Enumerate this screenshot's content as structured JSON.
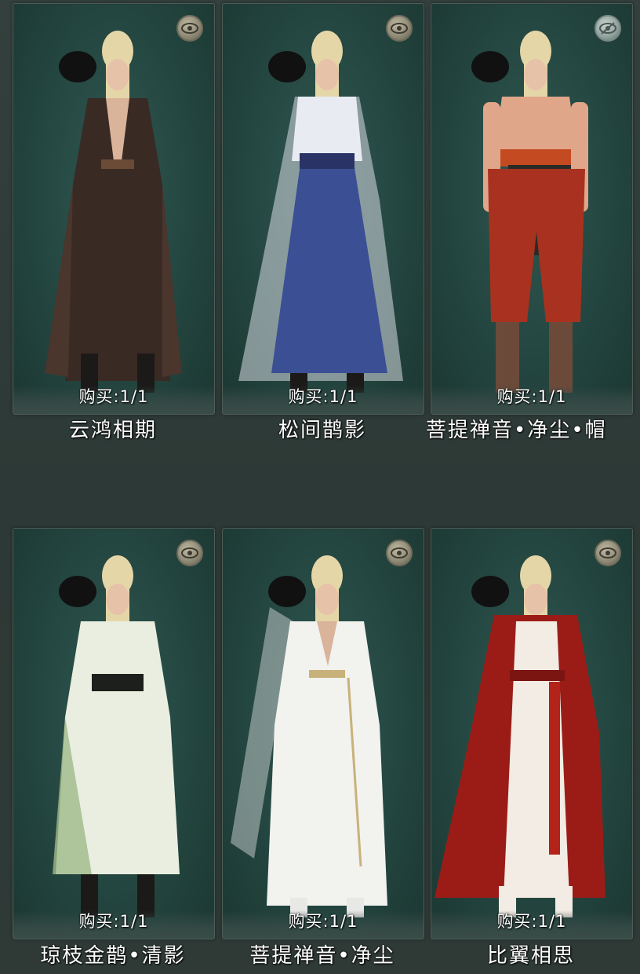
{
  "items": [
    {
      "name": "云鸿相期",
      "buy": "购买:1/1",
      "eye": "eye-icon",
      "outfit": "dark-robe",
      "colors": {
        "robe": "#3a2a24",
        "accent": "#6b4a36"
      }
    },
    {
      "name": "松间鹊影",
      "buy": "购买:1/1",
      "eye": "eye-icon",
      "outfit": "blue-white-robe",
      "colors": {
        "robe": "#3b4f95",
        "accent": "#e8ecf2"
      }
    },
    {
      "name": "菩提禅音•净尘•帽",
      "buy": "购买:1/1",
      "eye": "eye-off-icon",
      "outfit": "monk-bare",
      "colors": {
        "robe": "#a8321f",
        "accent": "#2a2a26"
      }
    },
    {
      "name": "琼枝金鹊•清影",
      "buy": "购买:1/1",
      "eye": "eye-icon",
      "outfit": "green-white-robe",
      "colors": {
        "robe": "#e9eee0",
        "accent": "#9fb98a"
      }
    },
    {
      "name": "菩提禅音•净尘",
      "buy": "购买:1/1",
      "eye": "eye-icon",
      "outfit": "white-robe",
      "colors": {
        "robe": "#f2f2ef",
        "accent": "#c8b27a"
      }
    },
    {
      "name": "比翼相思",
      "buy": "购买:1/1",
      "eye": "eye-icon",
      "outfit": "red-robe",
      "colors": {
        "robe": "#9b1c16",
        "accent": "#f2ece4"
      }
    }
  ]
}
